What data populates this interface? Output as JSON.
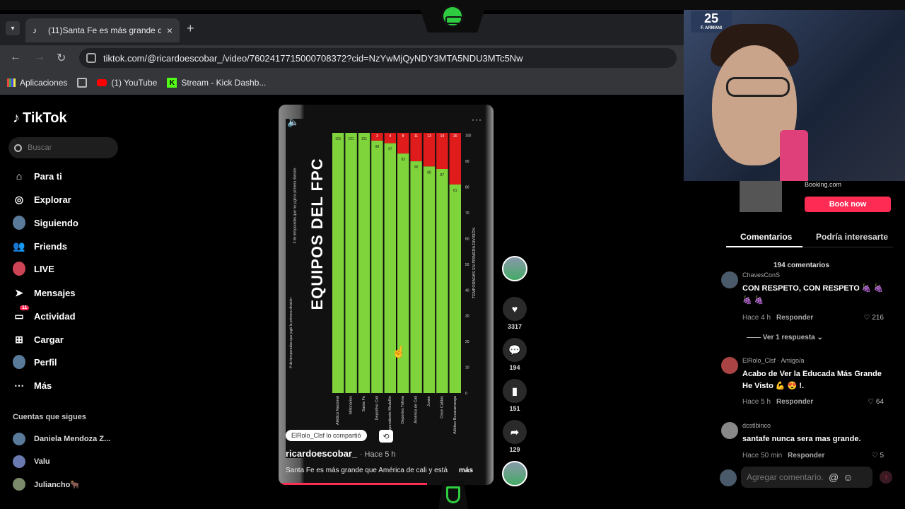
{
  "browser": {
    "tab_title": "(11)Santa Fe es más grande que",
    "url": "tiktok.com/@ricardoescobar_/video/7602417715000708372?cid=NzYwMjQyNDY3MTA5NDU3MTc5Nw",
    "bookmarks": [
      "Aplicaciones",
      "(1) YouTube",
      "Stream - Kick Dashb..."
    ]
  },
  "tiktok": {
    "logo": "TikTok",
    "search_placeholder": "Buscar",
    "nav": [
      "Para ti",
      "Explorar",
      "Siguiendo",
      "Friends",
      "LIVE",
      "Mensajes",
      "Actividad",
      "Cargar",
      "Perfil",
      "Más"
    ],
    "activity_badge": "11",
    "following_title": "Cuentas que sigues",
    "following": [
      "Daniela Mendoza Z...",
      "Valu",
      "Julianchо🐂"
    ]
  },
  "video": {
    "chart_title": "EQUIPOS DEL FPC",
    "legend_green": "# de temporadas que jugó la primera división",
    "legend_red": "# de temporadas que no jugó la primera división",
    "shared_label": "ElRolo_Clsf lo compartió",
    "author": "ricardoescobar_",
    "time": "· Hace 5 h",
    "caption": "Santa Fe es más grande que América de cali y está",
    "more": "más"
  },
  "chart_data": {
    "type": "bar",
    "categories": [
      "Atlético Nacional",
      "Millonarios",
      "Santa Fe",
      "Deportivo Cali",
      "Independiente Medellín",
      "Deportes Tolima",
      "América de Cali",
      "Junior",
      "Once Caldas",
      "Atlético Bucaramanga"
    ],
    "series": [
      {
        "name": "# de temporadas que jugó la primera división",
        "values": [
          101,
          101,
          101,
          98,
          97,
          93,
          90,
          88,
          87,
          81
        ]
      },
      {
        "name": "# de temporadas que no jugó la primera división",
        "values": [
          0,
          0,
          0,
          3,
          4,
          8,
          11,
          13,
          14,
          20
        ]
      }
    ],
    "xlabel": "",
    "ylabel": "TEMPORADAS EN PRIMERA DIVISIÓN",
    "ylim": [
      0,
      101
    ],
    "ticks": [
      0,
      10,
      20,
      30,
      40,
      50,
      60,
      70,
      80,
      90,
      100
    ],
    "colors": {
      "played": "#7ed43a",
      "not_played": "#e01b1b"
    }
  },
  "actions": {
    "likes": "3317",
    "comments": "194",
    "saves": "151",
    "shares": "129"
  },
  "ad": {
    "site": "Booking.com",
    "button": "Book now"
  },
  "comments_panel": {
    "tab_comments": "Comentarios",
    "tab_interest": "Podría interesarte",
    "count": "194 comentarios",
    "reply_label": "Responder",
    "view_reply": "Ver 1 respuesta",
    "items": [
      {
        "name": "ChavesConS",
        "text": "CON RESPETO, CON RESPETO 🍇 🍇 🍇 🍇",
        "time": "Hace 4 h",
        "likes": "216"
      },
      {
        "name": "ElRolo_Clsf · Amigo/a",
        "text": "Acabo de Ver la Educada Más Grande He Visto 💪 😍 !.",
        "time": "Hace 5 h",
        "likes": "64"
      },
      {
        "name": "dcstlbinco",
        "text": "santafe nunca sera mas grande.",
        "time": "Hace 50 min",
        "likes": "5"
      }
    ],
    "add_placeholder": "Agregar comentario..."
  },
  "webcam": {
    "jersey_number": "25",
    "jersey_name": "F. ARMANI"
  }
}
